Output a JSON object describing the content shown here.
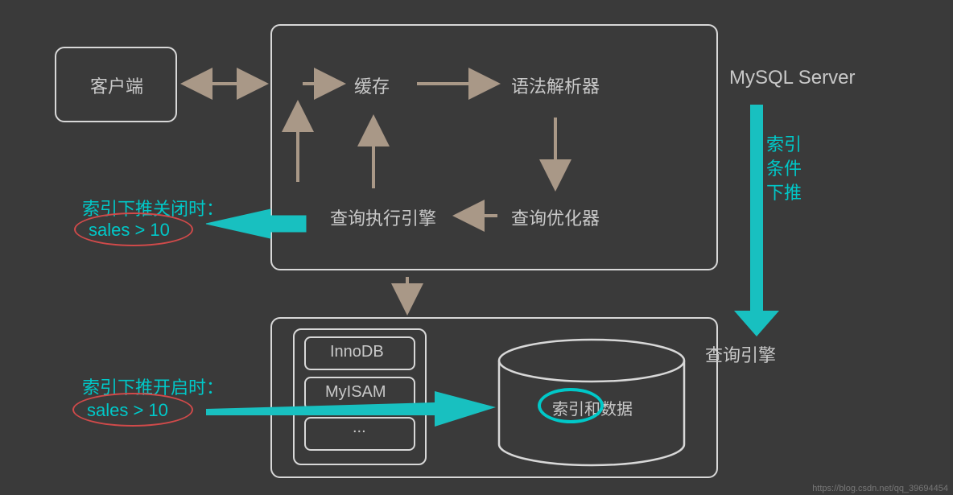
{
  "client": "客户端",
  "server_box_title": "MySQL Server",
  "cache": "缓存",
  "parser": "语法解析器",
  "optimizer": "查询优化器",
  "executor": "查询执行引擎",
  "push_down_label1": "索引",
  "push_down_label2": "条件",
  "push_down_label3": "下推",
  "storage_engine_label": "查询引擎",
  "engine_innodb": "InnoDB",
  "engine_myisam": "MyISAM",
  "engine_more": "...",
  "data_label": "索引和数据",
  "off_label": "索引下推关闭时：",
  "off_condition": "sales > 10",
  "on_label": "索引下推开启时：",
  "on_condition": "sales > 10",
  "watermark": "https://blog.csdn.net/qq_39694454"
}
